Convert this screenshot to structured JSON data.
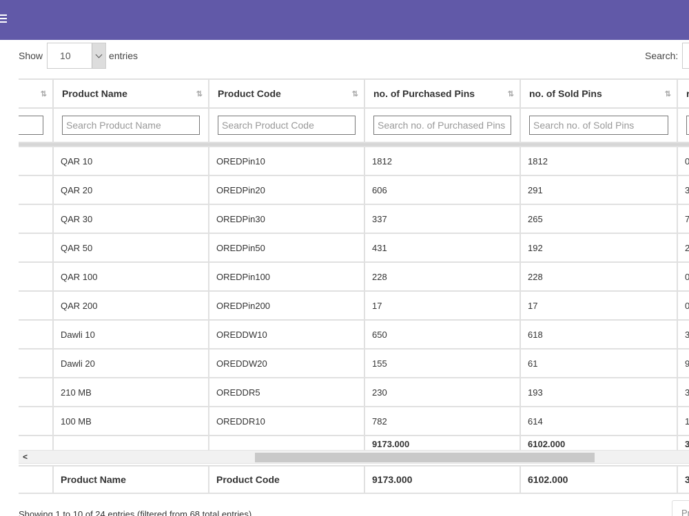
{
  "length": {
    "show_label": "Show",
    "value": "10",
    "entries_label": "entries"
  },
  "search": {
    "label": "Search:"
  },
  "columns": [
    {
      "header": "",
      "filter_placeholder": ""
    },
    {
      "header": "Product Name",
      "filter_placeholder": "Search Product Name"
    },
    {
      "header": "Product Code",
      "filter_placeholder": "Search Product Code"
    },
    {
      "header": "no. of Purchased Pins",
      "filter_placeholder": "Search no. of Purchased Pins"
    },
    {
      "header": "no. of Sold Pins",
      "filter_placeholder": "Search no. of Sold Pins"
    },
    {
      "header": "r",
      "filter_placeholder": ""
    }
  ],
  "rows": [
    {
      "name": "QAR 10",
      "code": "OREDPin10",
      "purchased": "1812",
      "sold": "1812",
      "next": "0"
    },
    {
      "name": "QAR 20",
      "code": "OREDPin20",
      "purchased": "606",
      "sold": "291",
      "next": "3"
    },
    {
      "name": "QAR 30",
      "code": "OREDPin30",
      "purchased": "337",
      "sold": "265",
      "next": "7"
    },
    {
      "name": "QAR 50",
      "code": "OREDPin50",
      "purchased": "431",
      "sold": "192",
      "next": "2"
    },
    {
      "name": "QAR 100",
      "code": "OREDPin100",
      "purchased": "228",
      "sold": "228",
      "next": "0"
    },
    {
      "name": "QAR 200",
      "code": "OREDPin200",
      "purchased": "17",
      "sold": "17",
      "next": "0"
    },
    {
      "name": "Dawli 10",
      "code": "OREDDW10",
      "purchased": "650",
      "sold": "618",
      "next": "3"
    },
    {
      "name": "Dawli 20",
      "code": "OREDDW20",
      "purchased": "155",
      "sold": "61",
      "next": "9"
    },
    {
      "name": "210 MB",
      "code": "OREDDR5",
      "purchased": "230",
      "sold": "193",
      "next": "3"
    },
    {
      "name": "100 MB",
      "code": "OREDDR10",
      "purchased": "782",
      "sold": "614",
      "next": "1"
    }
  ],
  "totals": {
    "purchased": "9173.000",
    "sold": "6102.000",
    "next": "3"
  },
  "footer": {
    "name": "Product Name",
    "code": "Product Code",
    "purchased": "9173.000",
    "sold": "6102.000",
    "next": "3"
  },
  "info": "Showing 1 to 10 of 24 entries (filtered from 68 total entries)",
  "pager": {
    "previous_label": "Pr"
  }
}
